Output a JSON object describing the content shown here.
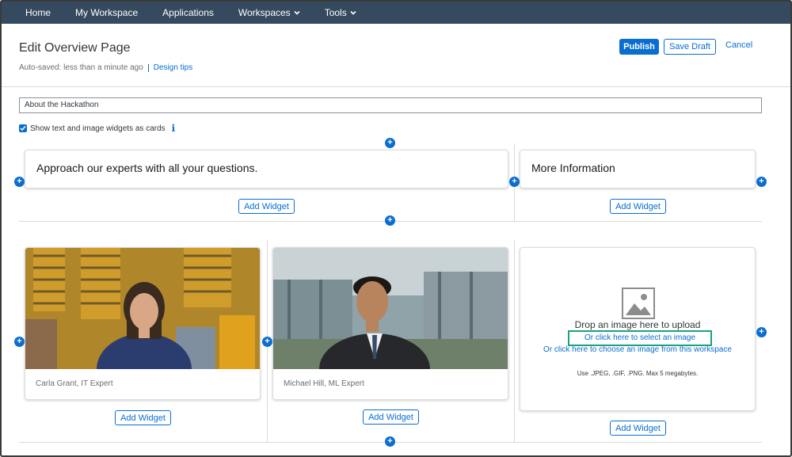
{
  "nav": {
    "items": [
      {
        "label": "Home",
        "dropdown": false
      },
      {
        "label": "My Workspace",
        "dropdown": false
      },
      {
        "label": "Applications",
        "dropdown": false
      },
      {
        "label": "Workspaces",
        "dropdown": true
      },
      {
        "label": "Tools",
        "dropdown": true
      }
    ]
  },
  "header": {
    "title": "Edit Overview Page",
    "autosave": "Auto-saved: less than a minute ago",
    "design_tips": "Design tips",
    "publish": "Publish",
    "save_draft": "Save Draft",
    "cancel": "Cancel"
  },
  "form": {
    "title_value": "About the Hackathon",
    "cards_toggle_label": "Show text and image widgets as cards",
    "cards_toggle_checked": true
  },
  "row1": {
    "text_widget_left": "Approach our experts with all your questions.",
    "text_widget_right": "More Information",
    "add_widget": "Add Widget"
  },
  "row2": {
    "card1_caption": "Carla Grant, IT Expert",
    "card2_caption": "Michael Hill, ML Expert",
    "upload": {
      "drop_text": "Drop an image here to upload",
      "select_link": "Or click here to select an image",
      "workspace_link": "Or click here to choose an image from this workspace",
      "formats": "Use .JPEG, .GIF, .PNG. Max 5 megabytes."
    },
    "add_widget": "Add Widget"
  },
  "icons": {
    "plus": "+",
    "info": "i"
  },
  "colors": {
    "nav_bg": "#354a5f",
    "accent": "#0a6ed1",
    "highlight": "#1aa37a"
  }
}
